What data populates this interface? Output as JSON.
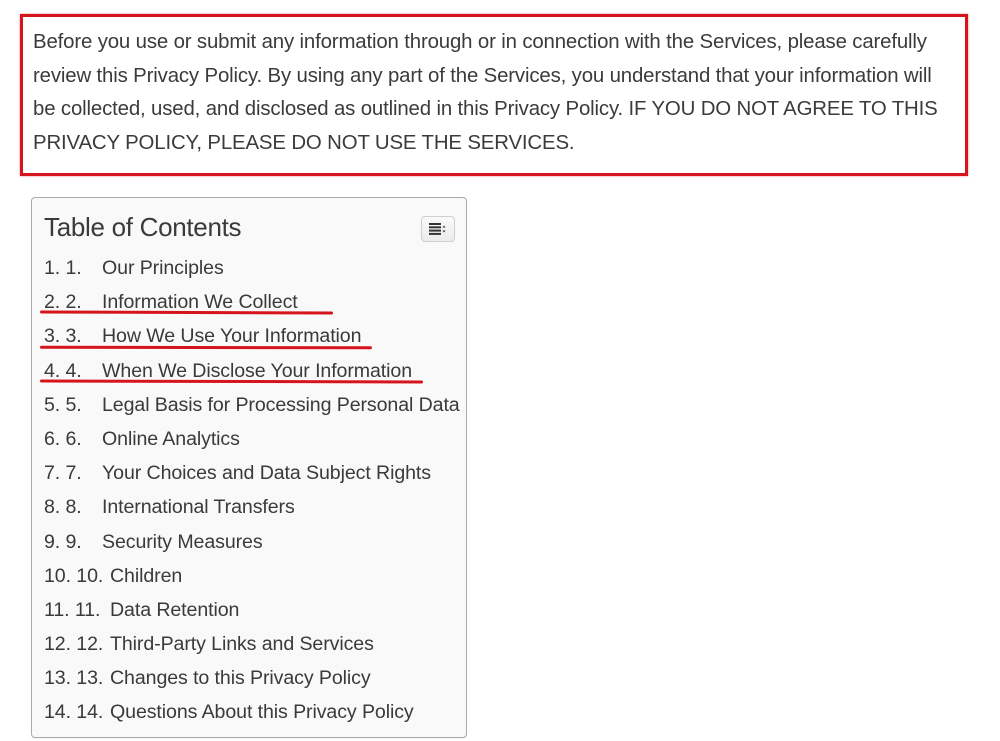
{
  "notice": {
    "text": "Before you use or submit any information through or in connection with the Services, please carefully review this Privacy Policy. By using any part of the Services, you understand that your information will be collected, used, and disclosed as outlined in this Privacy Policy. IF YOU DO NOT AGREE TO THIS PRIVACY POLICY, PLEASE DO NOT USE THE SERVICES.",
    "highlight_color": "#d6141c"
  },
  "toc": {
    "title": "Table of Contents",
    "toggle_icon": "list-toggle-icon",
    "items": [
      {
        "number": "1. 1.",
        "label": "Our Principles",
        "highlighted": false
      },
      {
        "number": "2. 2.",
        "label": "Information We Collect",
        "highlighted": true
      },
      {
        "number": "3. 3.",
        "label": "How We Use Your Information",
        "highlighted": true
      },
      {
        "number": "4. 4.",
        "label": "When We Disclose Your Information",
        "highlighted": true
      },
      {
        "number": "5. 5.",
        "label": "Legal Basis for Processing Personal Data",
        "highlighted": false
      },
      {
        "number": "6. 6.",
        "label": "Online Analytics",
        "highlighted": false
      },
      {
        "number": "7. 7.",
        "label": "Your Choices and Data Subject Rights",
        "highlighted": false
      },
      {
        "number": "8. 8.",
        "label": "International Transfers",
        "highlighted": false
      },
      {
        "number": "9. 9.",
        "label": "Security Measures",
        "highlighted": false
      },
      {
        "number": "10. 10.",
        "label": "Children",
        "highlighted": false
      },
      {
        "number": "11. 11.",
        "label": "Data Retention",
        "highlighted": false
      },
      {
        "number": "12. 12.",
        "label": "Third-Party Links and Services",
        "highlighted": false
      },
      {
        "number": "13. 13.",
        "label": "Changes to this Privacy Policy",
        "highlighted": false
      },
      {
        "number": "14. 14.",
        "label": "Questions About this Privacy Policy",
        "highlighted": false
      }
    ]
  }
}
